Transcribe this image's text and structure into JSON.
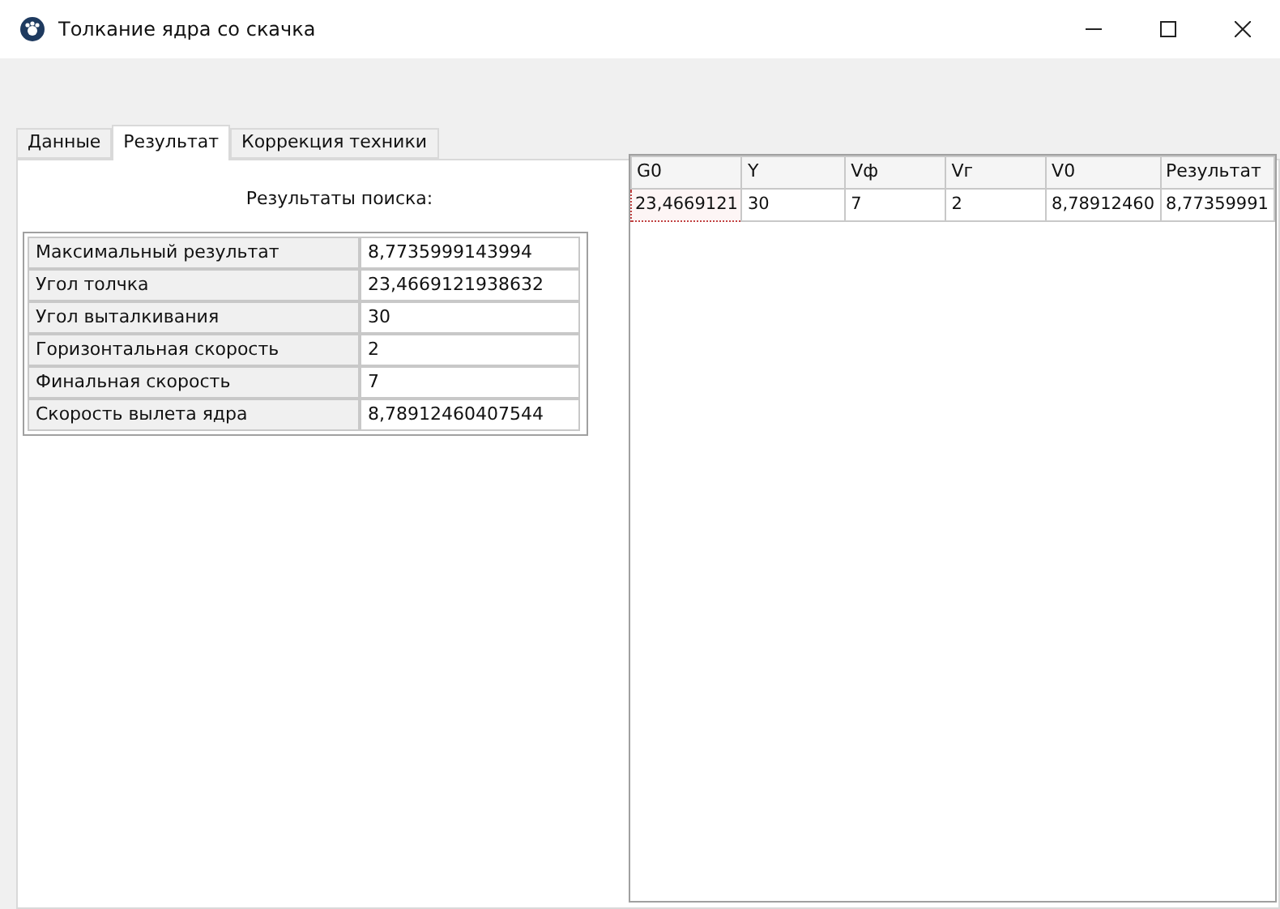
{
  "window": {
    "title": "Толкание ядра со скачка"
  },
  "tabs": [
    {
      "label": "Данные",
      "selected": false
    },
    {
      "label": "Результат",
      "selected": true
    },
    {
      "label": "Коррекция техники",
      "selected": false
    }
  ],
  "results_heading": "Результаты поиска:",
  "results": [
    {
      "label": "Максимальный результат",
      "value": "8,7735999143994"
    },
    {
      "label": "Угол толчка",
      "value": "23,4669121938632"
    },
    {
      "label": "Угол выталкивания",
      "value": "30"
    },
    {
      "label": "Горизонтальная скорость",
      "value": "2"
    },
    {
      "label": "Финальная скорость",
      "value": "7"
    },
    {
      "label": "Скорость вылета ядра",
      "value": "8,78912460407544"
    }
  ],
  "grid": {
    "columns": [
      "G0",
      "Y",
      "Vф",
      "Vг",
      "V0",
      "Результат"
    ],
    "rows": [
      [
        {
          "text": "23,4669121",
          "selected": true
        },
        {
          "text": "30",
          "selected": false
        },
        {
          "text": "7",
          "selected": false
        },
        {
          "text": "2",
          "selected": false
        },
        {
          "text": "8,78912460",
          "selected": false
        },
        {
          "text": "8,77359991",
          "selected": false
        }
      ]
    ]
  }
}
